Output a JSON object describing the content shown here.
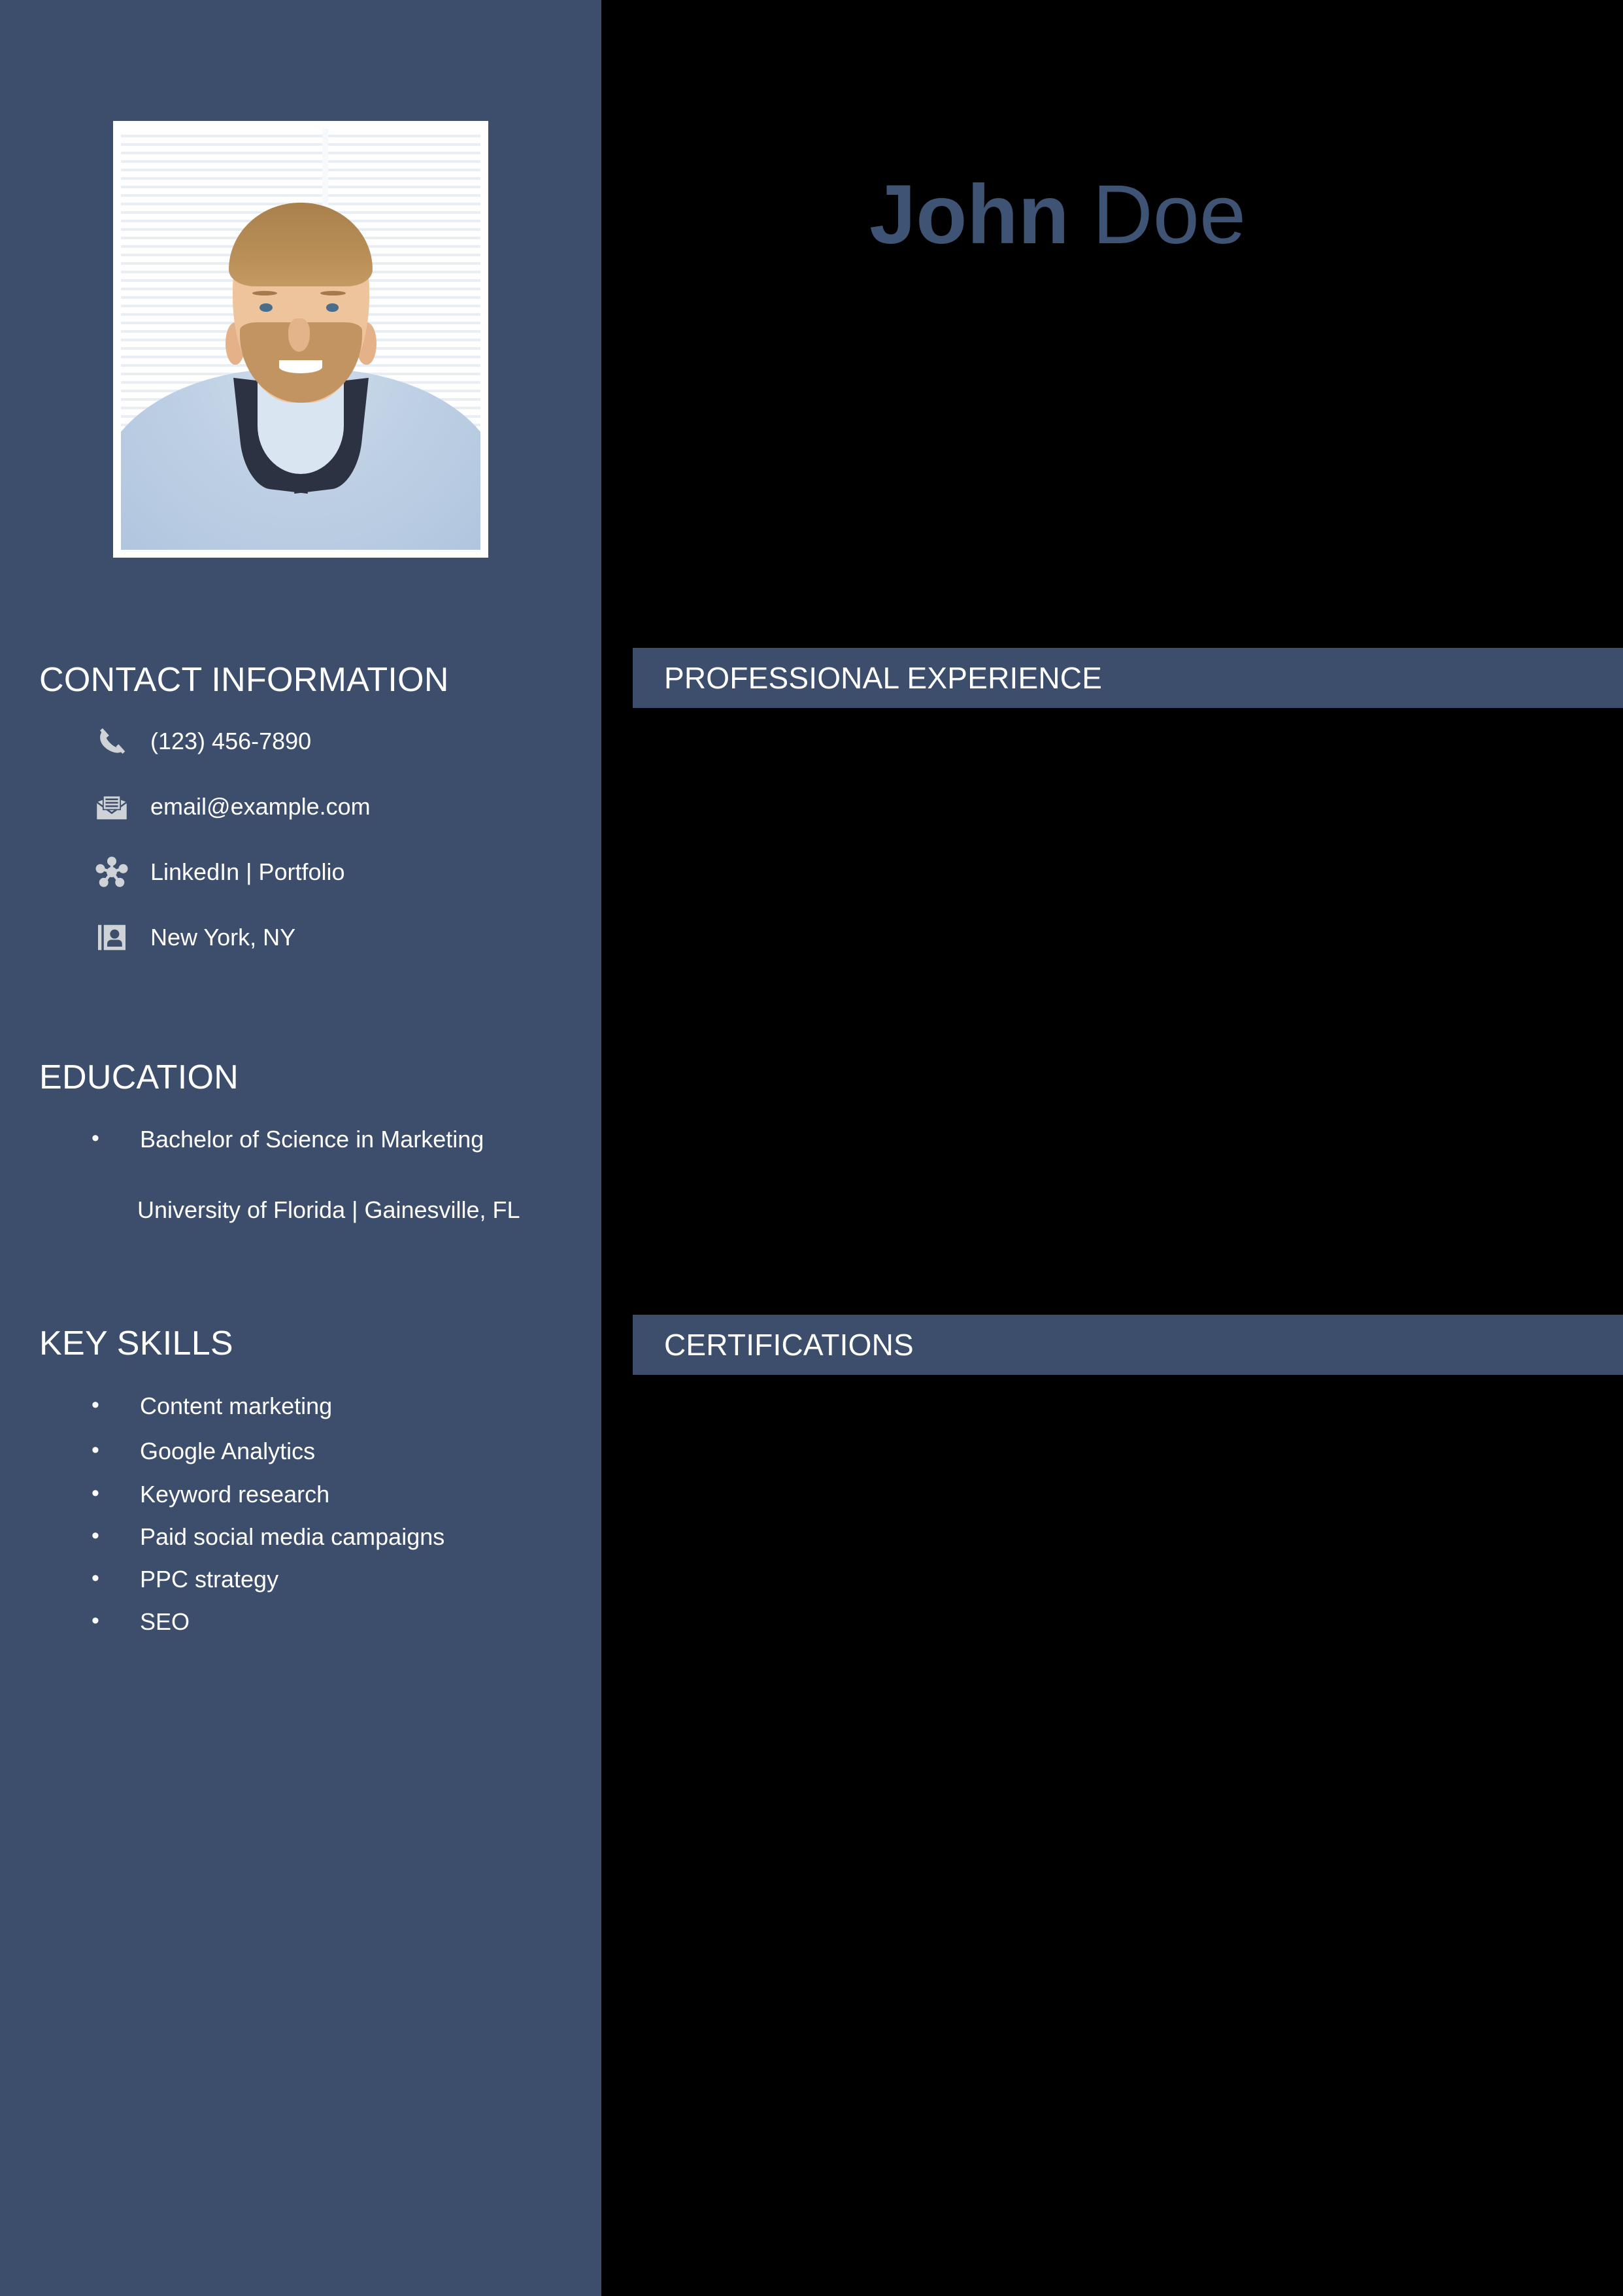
{
  "theme": {
    "sidebar_bg": "#3C4E6B",
    "main_bg": "#000000",
    "accent_bar": "#3C4E6B",
    "name_color": "#3F5374",
    "text_color": "#FFFFFF",
    "icon_color": "#CFD2D6"
  },
  "header": {
    "name_first": "John",
    "name_last": " Doe"
  },
  "photo": {
    "alt": "profile-photo"
  },
  "sidebar": {
    "contact": {
      "heading": "CONTACT INFORMATION",
      "items": [
        {
          "icon": "phone-icon",
          "value": "(123) 456-7890"
        },
        {
          "icon": "email-icon",
          "value": "email@example.com"
        },
        {
          "icon": "network-icon",
          "value": "LinkedIn | Portfolio"
        },
        {
          "icon": "address-book-icon",
          "value": "New York, NY"
        }
      ]
    },
    "education": {
      "heading": "EDUCATION",
      "items": [
        {
          "degree": "Bachelor of Science in Marketing",
          "school": "University of Florida | Gainesville, FL"
        }
      ]
    },
    "skills": {
      "heading": "KEY SKILLS",
      "items": [
        "Content marketing",
        "Google Analytics",
        "Keyword research",
        "Paid social media campaigns",
        "PPC strategy",
        "SEO"
      ]
    }
  },
  "main": {
    "sections": [
      {
        "heading": "PROFESSIONAL EXPERIENCE",
        "entries": []
      },
      {
        "heading": "CERTIFICATIONS",
        "entries": []
      }
    ]
  }
}
